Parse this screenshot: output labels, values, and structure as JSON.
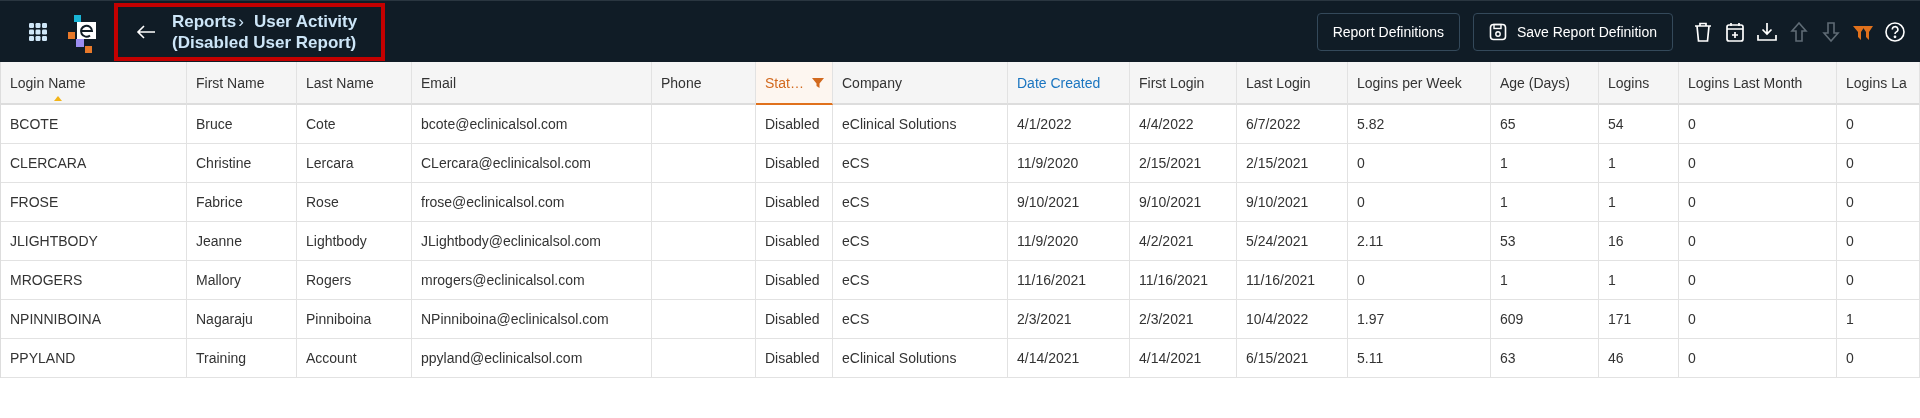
{
  "header": {
    "breadcrumb_parent": "Reports",
    "separator": "›",
    "title": "User Activity",
    "subtitle": "(Disabled User Report)",
    "highlighted": true,
    "buttons": [
      {
        "label": "Report Definitions",
        "kind": "plain"
      },
      {
        "label": "Save Report Definition",
        "kind": "save"
      }
    ],
    "tools": [
      {
        "kind": "trash",
        "disabled": false,
        "active": false
      },
      {
        "kind": "calendar",
        "disabled": false,
        "active": false
      },
      {
        "kind": "download",
        "disabled": false,
        "active": false
      },
      {
        "kind": "up",
        "disabled": true,
        "active": false
      },
      {
        "kind": "down",
        "disabled": true,
        "active": false
      },
      {
        "kind": "filter",
        "disabled": false,
        "active": true
      },
      {
        "kind": "help",
        "disabled": false,
        "active": false
      }
    ]
  },
  "table": {
    "columns": [
      {
        "label": "Login Name",
        "sorted": true,
        "filtered": false,
        "highlighted": false
      },
      {
        "label": "First Name",
        "sorted": false,
        "filtered": false,
        "highlighted": false
      },
      {
        "label": "Last Name",
        "sorted": false,
        "filtered": false,
        "highlighted": false
      },
      {
        "label": "Email",
        "sorted": false,
        "filtered": false,
        "highlighted": false
      },
      {
        "label": "Phone",
        "sorted": false,
        "filtered": false,
        "highlighted": false
      },
      {
        "label": "Stat…",
        "sorted": false,
        "filtered": true,
        "highlighted": false
      },
      {
        "label": "Company",
        "sorted": false,
        "filtered": false,
        "highlighted": false
      },
      {
        "label": "Date Created",
        "sorted": false,
        "filtered": false,
        "highlighted": true
      },
      {
        "label": "First Login",
        "sorted": false,
        "filtered": false,
        "highlighted": false
      },
      {
        "label": "Last Login",
        "sorted": false,
        "filtered": false,
        "highlighted": false
      },
      {
        "label": "Logins per Week",
        "sorted": false,
        "filtered": false,
        "highlighted": false
      },
      {
        "label": "Age (Days)",
        "sorted": false,
        "filtered": false,
        "highlighted": false
      },
      {
        "label": "Logins",
        "sorted": false,
        "filtered": false,
        "highlighted": false
      },
      {
        "label": "Logins Last Month",
        "sorted": false,
        "filtered": false,
        "highlighted": false
      },
      {
        "label": "Logins La",
        "sorted": false,
        "filtered": false,
        "highlighted": false
      }
    ],
    "rows": [
      [
        "BCOTE",
        "Bruce",
        "Cote",
        "bcote@eclinicalsol.com",
        "",
        "Disabled",
        "eClinical Solutions",
        "4/1/2022",
        "4/4/2022",
        "6/7/2022",
        "5.82",
        "65",
        "54",
        "0",
        "0"
      ],
      [
        "CLERCARA",
        "Christine",
        "Lercara",
        "CLercara@eclinicalsol.com",
        "",
        "Disabled",
        "eCS",
        "11/9/2020",
        "2/15/2021",
        "2/15/2021",
        "0",
        "1",
        "1",
        "0",
        "0"
      ],
      [
        "FROSE",
        "Fabrice",
        "Rose",
        "frose@eclinicalsol.com",
        "",
        "Disabled",
        "eCS",
        "9/10/2021",
        "9/10/2021",
        "9/10/2021",
        "0",
        "1",
        "1",
        "0",
        "0"
      ],
      [
        "JLIGHTBODY",
        "Jeanne",
        "Lightbody",
        "JLightbody@eclinicalsol.com",
        "",
        "Disabled",
        "eCS",
        "11/9/2020",
        "4/2/2021",
        "5/24/2021",
        "2.11",
        "53",
        "16",
        "0",
        "0"
      ],
      [
        "MROGERS",
        "Mallory",
        "Rogers",
        "mrogers@eclinicalsol.com",
        "",
        "Disabled",
        "eCS",
        "11/16/2021",
        "11/16/2021",
        "11/16/2021",
        "0",
        "1",
        "1",
        "0",
        "0"
      ],
      [
        "NPINNIBOINA",
        "Nagaraju",
        "Pinniboina",
        "NPinniboina@eclinicalsol.com",
        "",
        "Disabled",
        "eCS",
        "2/3/2021",
        "2/3/2021",
        "10/4/2022",
        "1.97",
        "609",
        "171",
        "0",
        "1"
      ],
      [
        "PPYLAND",
        "Training",
        "Account",
        "ppyland@eclinicalsol.com",
        "",
        "Disabled",
        "eClinical Solutions",
        "4/14/2021",
        "4/14/2021",
        "6/15/2021",
        "5.11",
        "63",
        "46",
        "0",
        "0"
      ]
    ]
  }
}
